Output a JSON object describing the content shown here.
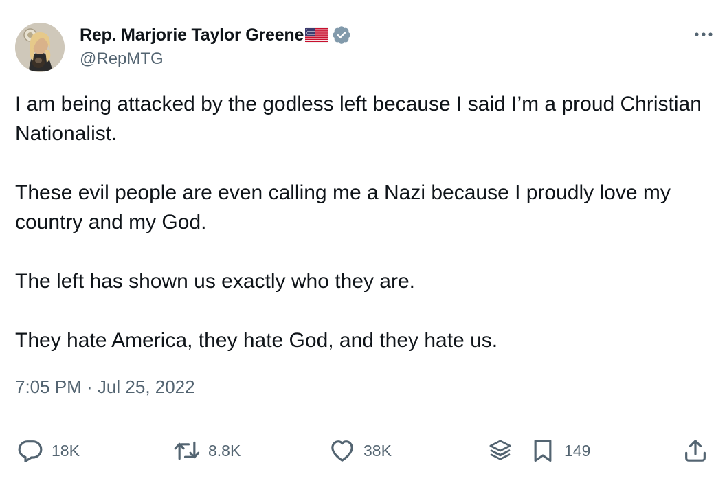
{
  "author": {
    "display_name": "Rep. Marjorie Taylor Greene",
    "handle": "@RepMTG"
  },
  "tweet": {
    "paragraphs": [
      "I am being attacked by the godless left because I said I’m a proud Christian Nationalist.",
      "These evil people are even calling me a Nazi because I proudly love my country and my God.",
      "The left has shown us exactly who they are.",
      "They hate America, they hate God, and they hate us."
    ],
    "timestamp": "7:05 PM · Jul 25, 2022"
  },
  "actions": {
    "replies": "18K",
    "retweets": "8.8K",
    "likes": "38K",
    "bookmarks": "149"
  },
  "icons": {
    "flag": "us-flag-icon",
    "verified": "verified-badge-icon",
    "more": "more-options-icon",
    "reply": "reply-icon",
    "retweet": "retweet-icon",
    "like": "heart-icon",
    "views": "views-icon",
    "bookmark": "bookmark-icon",
    "share": "share-icon"
  },
  "colors": {
    "text_primary": "#0f1419",
    "text_secondary": "#536471",
    "verified_badge": "#829aab",
    "divider": "#eff3f4"
  }
}
